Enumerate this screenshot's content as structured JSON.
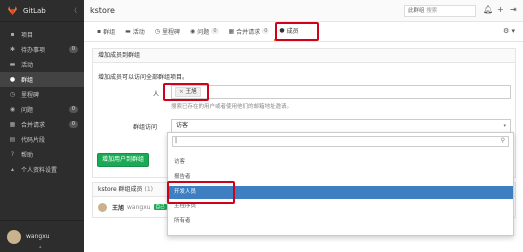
{
  "brand": {
    "name": "GitLab",
    "collapse": "〈"
  },
  "sidebar": {
    "items": [
      {
        "icon": "home-icon",
        "glyph": "▪",
        "label": "项目",
        "count": ""
      },
      {
        "icon": "todo-icon",
        "glyph": "✱",
        "label": "待办事项",
        "count": "0"
      },
      {
        "icon": "activity-icon",
        "glyph": "▬",
        "label": "活动",
        "count": ""
      },
      {
        "icon": "group-icon",
        "glyph": "●",
        "label": "群组",
        "count": "",
        "active": true
      },
      {
        "icon": "milestone-icon",
        "glyph": "◷",
        "label": "里程碑",
        "count": ""
      },
      {
        "icon": "issues-icon",
        "glyph": "◉",
        "label": "问题",
        "count": "0"
      },
      {
        "icon": "merge-request-icon",
        "glyph": "▦",
        "label": "合并请求",
        "count": "0"
      },
      {
        "icon": "snippets-icon",
        "glyph": "▤",
        "label": "代码片段",
        "count": ""
      },
      {
        "icon": "help-icon",
        "glyph": "?",
        "label": "帮助",
        "count": ""
      },
      {
        "icon": "profile-icon",
        "glyph": "▴",
        "label": "个人资料设置",
        "count": ""
      }
    ]
  },
  "user": {
    "name": "wangxu",
    "caret": "▴"
  },
  "topbar": {
    "title": "kstore",
    "search_scope": "此群组",
    "search_placeholder": "搜索"
  },
  "subnav": {
    "tabs": [
      {
        "icon": "group-icon",
        "glyph": "▪",
        "label": "群组",
        "count": ""
      },
      {
        "icon": "activity-icon",
        "glyph": "▬",
        "label": "活动",
        "count": ""
      },
      {
        "icon": "milestone-icon",
        "glyph": "◷",
        "label": "里程碑",
        "count": ""
      },
      {
        "icon": "issues-icon",
        "glyph": "◉",
        "label": "问题",
        "count": "0"
      },
      {
        "icon": "merge-request-icon",
        "glyph": "▦",
        "label": "合并请求",
        "count": "0"
      },
      {
        "icon": "members-icon",
        "glyph": "●",
        "label": "成员",
        "count": "",
        "active": true
      }
    ],
    "settings_glyph": "⚙ ▾"
  },
  "add_panel": {
    "heading": "增加成员到群组",
    "description": "增加成员可以访问全部群组项目。",
    "people_label": "人",
    "token": "王旭",
    "token_remove": "×",
    "people_help": "搜索已存在的用户或者使用他们的邮箱地址邀请。",
    "access_label": "群组访问",
    "access_value": "访客",
    "submit": "增加用户到群组"
  },
  "members": {
    "heading": "kstore 群组成员",
    "count": "(1)",
    "rows": [
      {
        "name": "王旭",
        "username": "wangxu",
        "badge": "自己"
      }
    ]
  },
  "dropdown": {
    "search_value": "|",
    "options": [
      {
        "label": "访客",
        "selected": false
      },
      {
        "label": "报告者",
        "selected": false
      },
      {
        "label": "开发人员",
        "selected": true
      },
      {
        "label": "主程序员",
        "selected": false
      },
      {
        "label": "所有者",
        "selected": false
      }
    ]
  },
  "colors": {
    "sidebar_bg": "#2d2d2d",
    "active_tab": "#fc6d26",
    "primary_button": "#1aaa55",
    "selected_option": "#3d7fc1",
    "highlight_box": "#d0021b"
  }
}
